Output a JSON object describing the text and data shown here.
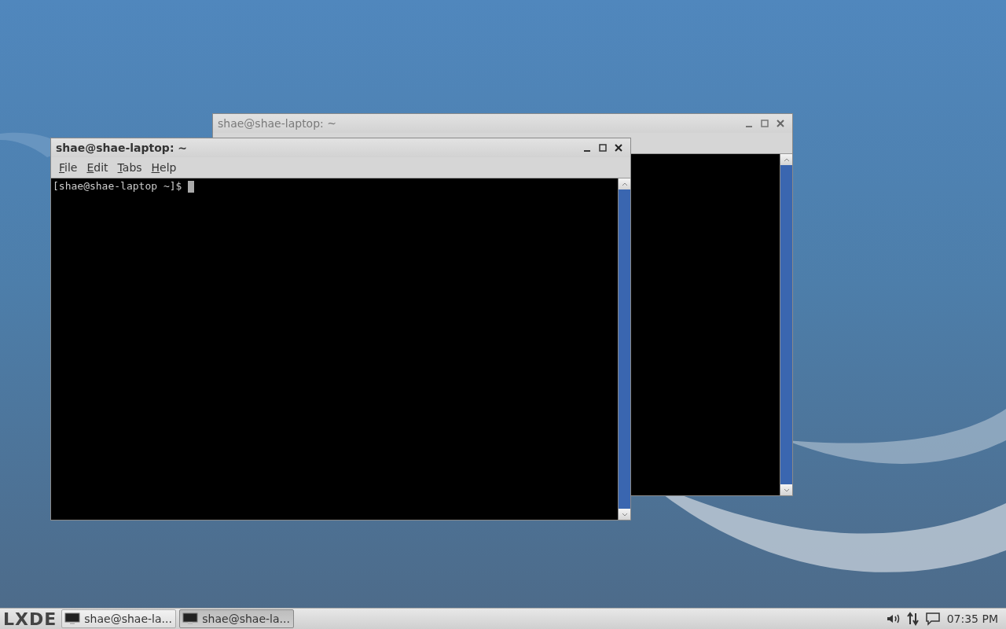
{
  "windows": [
    {
      "title": "shae@shae-laptop: ~",
      "active": false
    },
    {
      "title": "shae@shae-laptop: ~",
      "active": true,
      "menu": [
        "File",
        "Edit",
        "Tabs",
        "Help"
      ],
      "prompt": "[shae@shae-laptop ~]$ "
    }
  ],
  "taskbar": {
    "logo": "LXDE",
    "tasks": [
      {
        "label": "shae@shae-la...",
        "selected": false
      },
      {
        "label": "shae@shae-la...",
        "selected": true
      }
    ],
    "clock": "07:35 PM"
  }
}
